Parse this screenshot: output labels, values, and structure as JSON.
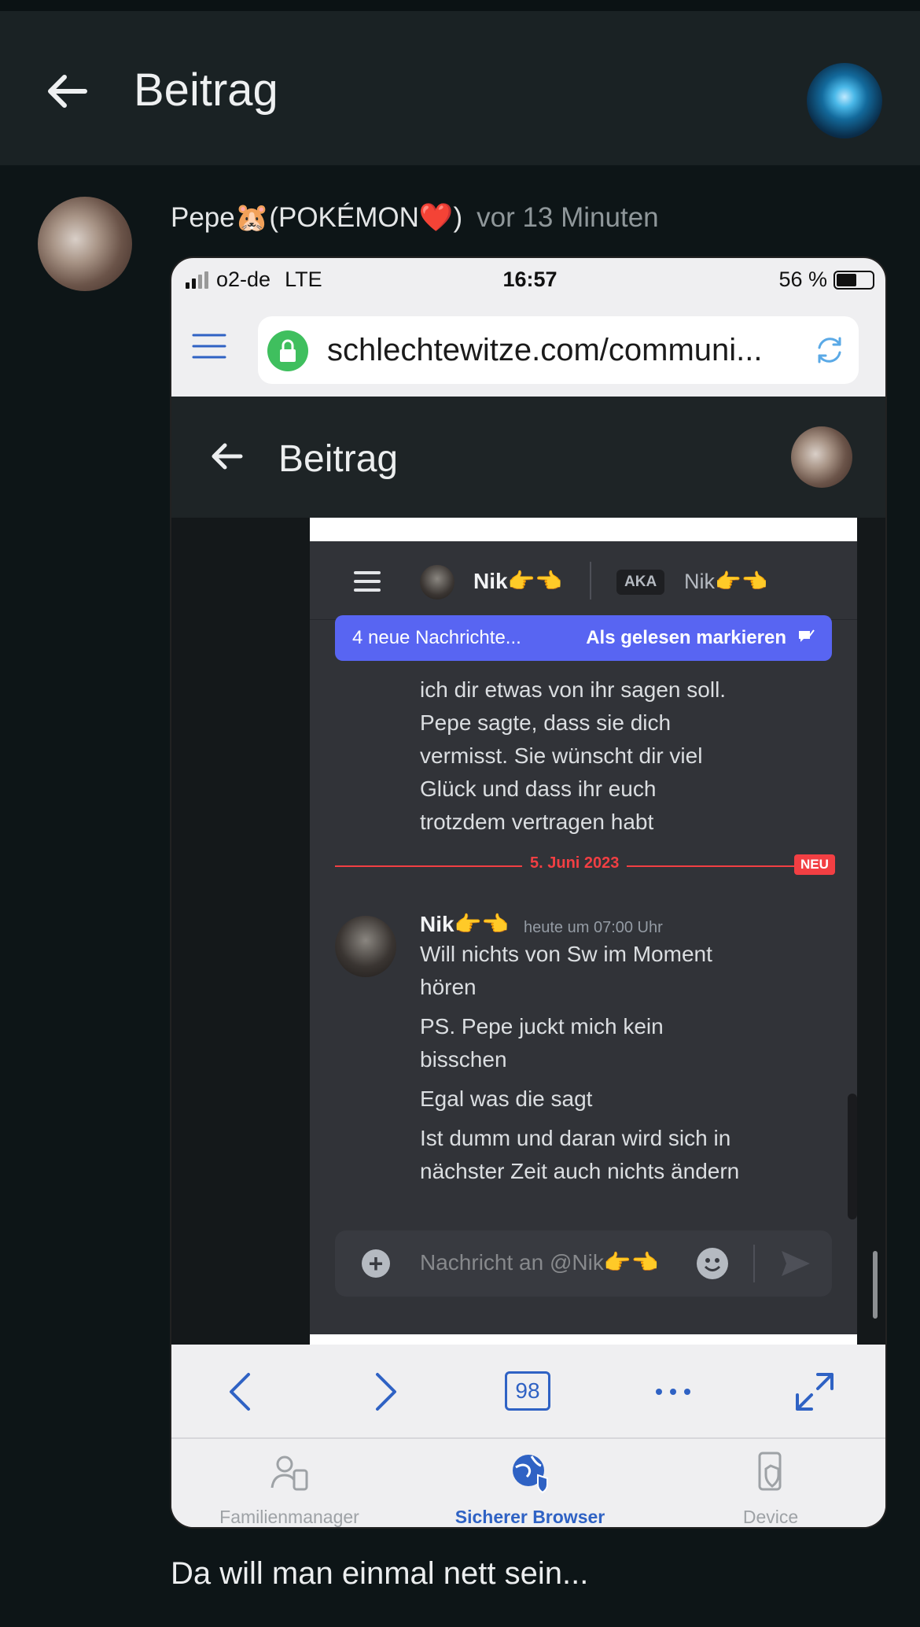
{
  "appbar": {
    "title": "Beitrag"
  },
  "post": {
    "author": "Pepe🐹(POKÉMON❤️)",
    "time": "vor 13 Minuten",
    "caption": "Da will man einmal nett sein..."
  },
  "phone": {
    "status": {
      "carrier": "o2-de",
      "network": "LTE",
      "clock": "16:57",
      "battery": "56 %",
      "battery_level": 0.56
    },
    "url": "schlechtewitze.com/communi...",
    "inner_title": "Beitrag",
    "discord": {
      "user_name": "Nik👉👈",
      "aka_label": "AKA",
      "aka_name": "Nik👉👈",
      "new_messages": "4 neue Nachrichte...",
      "mark_read": "Als gelesen markieren",
      "prev_message_lines": [
        "ich dir etwas von ihr sagen soll.",
        "Pepe sagte, dass sie dich",
        "vermisst. Sie wünscht dir viel",
        "Glück und dass ihr euch",
        "trotzdem vertragen habt"
      ],
      "date_divider": "5. Juni 2023",
      "new_badge": "NEU",
      "message_author": "Nik👉👈",
      "message_time": "heute um 07:00 Uhr",
      "messages": [
        [
          "Will nichts von Sw im Moment",
          "hören"
        ],
        [
          "PS. Pepe juckt mich kein",
          "bisschen"
        ],
        [
          "Egal was die sagt"
        ],
        [
          "Ist dumm und daran wird sich in",
          "nächster Zeit auch nichts ändern"
        ]
      ],
      "composer_placeholder": "Nachricht an @Nik👉👈"
    },
    "toolbar": {
      "tabs_count": "98"
    },
    "bottom_nav": [
      {
        "label": "Familienmanager",
        "icon": "family-icon",
        "active": false
      },
      {
        "label": "Sicherer Browser",
        "icon": "secure-globe-icon",
        "active": true
      },
      {
        "label": "Device",
        "icon": "device-shield-icon",
        "active": false
      }
    ]
  },
  "colors": {
    "accent": "#2f62c4",
    "discord_blurple": "#5865f2",
    "discord_red": "#f23f43",
    "background": "#0d1517"
  }
}
